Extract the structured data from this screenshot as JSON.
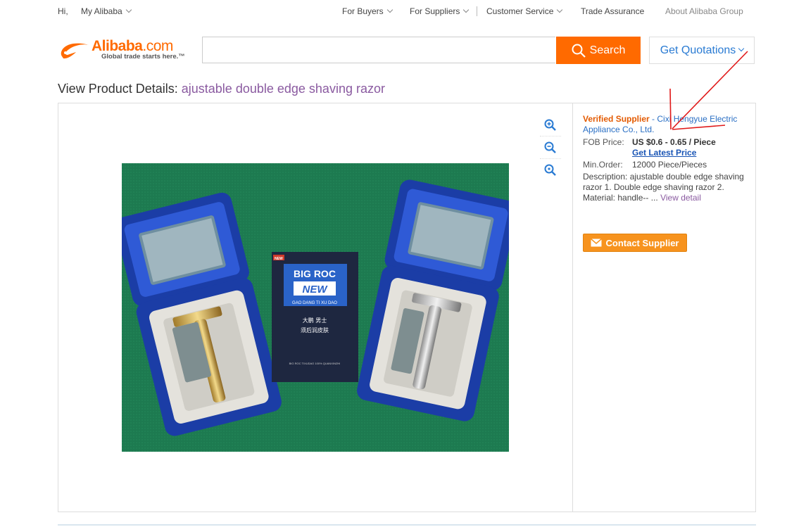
{
  "topbar": {
    "greeting": "Hi,",
    "my_alibaba": "My Alibaba",
    "for_buyers": "For Buyers",
    "for_suppliers": "For Suppliers",
    "customer_service": "Customer Service",
    "trade_assurance": "Trade Assurance",
    "about": "About Alibaba Group"
  },
  "header": {
    "logo_text": "Alibaba",
    "logo_suffix": ".com",
    "logo_tagline": "Global trade starts here.™",
    "search_placeholder": "",
    "search_value": "",
    "search_label": "Search",
    "quotations_label": "Get Quotations"
  },
  "title": {
    "prefix": "View Product Details:",
    "product": "ajustable double edge shaving razor"
  },
  "info": {
    "verified": "Verified Supplier",
    "dash": " - ",
    "supplier": "Cixi Hengyue Electric Appliance Co., Ltd.",
    "fob_label": "FOB Price:",
    "fob_value": "US $0.6 - 0.65 / Piece",
    "latest_price": "Get Latest Price",
    "min_order_label": "Min.Order:",
    "min_order_value": "12000 Piece/Pieces",
    "desc_label": "Description:",
    "desc_value": "ajustable double edge shaving razor 1. Double edge shaving razor 2. Material: handle-- ...",
    "view_detail": "View detail",
    "contact": "Contact Supplier"
  },
  "image": {
    "box_brand": "BIG ROC",
    "box_new": "NEW",
    "box_sub": "GAO DANG TI XU DAO",
    "box_cn1": "大鹏  男士",
    "box_cn2": "须后润皮肤",
    "box_foot": "BIG ROC TIXUDAO 100% QUANXINZHI",
    "corner_tag": "NEW"
  },
  "colors": {
    "brand": "#ff6a00",
    "link": "#2a6fc4",
    "verified": "#e35a00",
    "contact": "#f7931e"
  },
  "icons": [
    "caret-down-icon",
    "search-icon",
    "zoom-in-icon",
    "zoom-out-icon",
    "zoom-reset-icon",
    "envelope-icon"
  ]
}
